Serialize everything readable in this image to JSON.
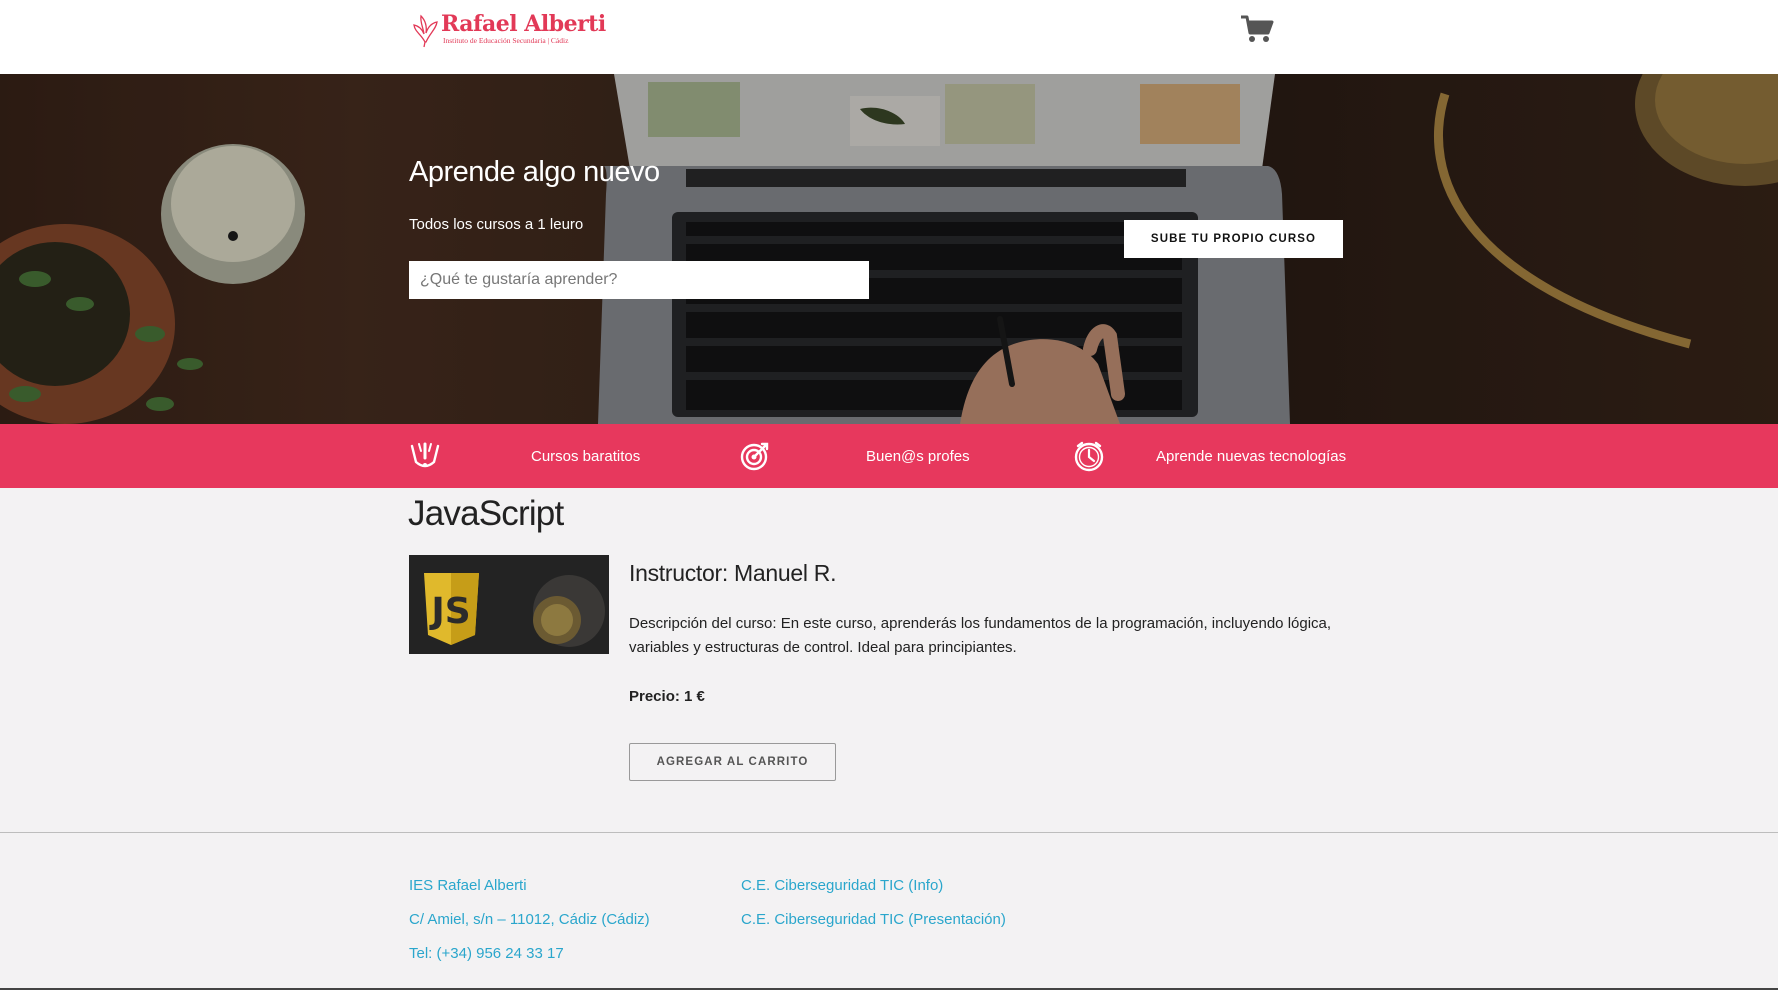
{
  "header": {
    "logo": {
      "title": "Rafael Alberti",
      "subtitle": "Instituto de Educación Secundaria | Cádiz"
    },
    "cart_icon": "shopping-cart-icon"
  },
  "hero": {
    "title": "Aprende algo nuevo",
    "subtitle": "Todos los cursos a 1 leuro",
    "search_placeholder": "¿Qué te gustaría aprender?",
    "upload_button": "SUBE TU PROPIO CURSO"
  },
  "features": [
    {
      "icon": "light-bulb-icon",
      "label": "Cursos baratitos"
    },
    {
      "icon": "target-icon",
      "label": "Buen@s profes"
    },
    {
      "icon": "clock-icon",
      "label": "Aprende nuevas tecnologías"
    }
  ],
  "course": {
    "title": "JavaScript",
    "instructor": "Instructor: Manuel R.",
    "description": "Descripción del curso: En este curso, aprenderás los fundamentos de la programación, incluyendo lógica, variables y estructuras de control. Ideal para principiantes.",
    "price": "Precio: 1 €",
    "add_to_cart": "AGREGAR AL CARRITO",
    "thumbnail_text": "JS"
  },
  "footer": {
    "col1": [
      "IES Rafael Alberti",
      "C/ Amiel, s/n – 11012, Cádiz (Cádiz)",
      "Tel: (+34) 956 24 33 17"
    ],
    "col2": [
      "C.E. Ciberseguridad TIC (Info)",
      "C.E. Ciberseguridad TIC (Presentación)"
    ]
  },
  "colors": {
    "accent": "#e7385d",
    "logo": "#e23957",
    "link": "#2aa6cc",
    "background": "#f3f2f3"
  }
}
